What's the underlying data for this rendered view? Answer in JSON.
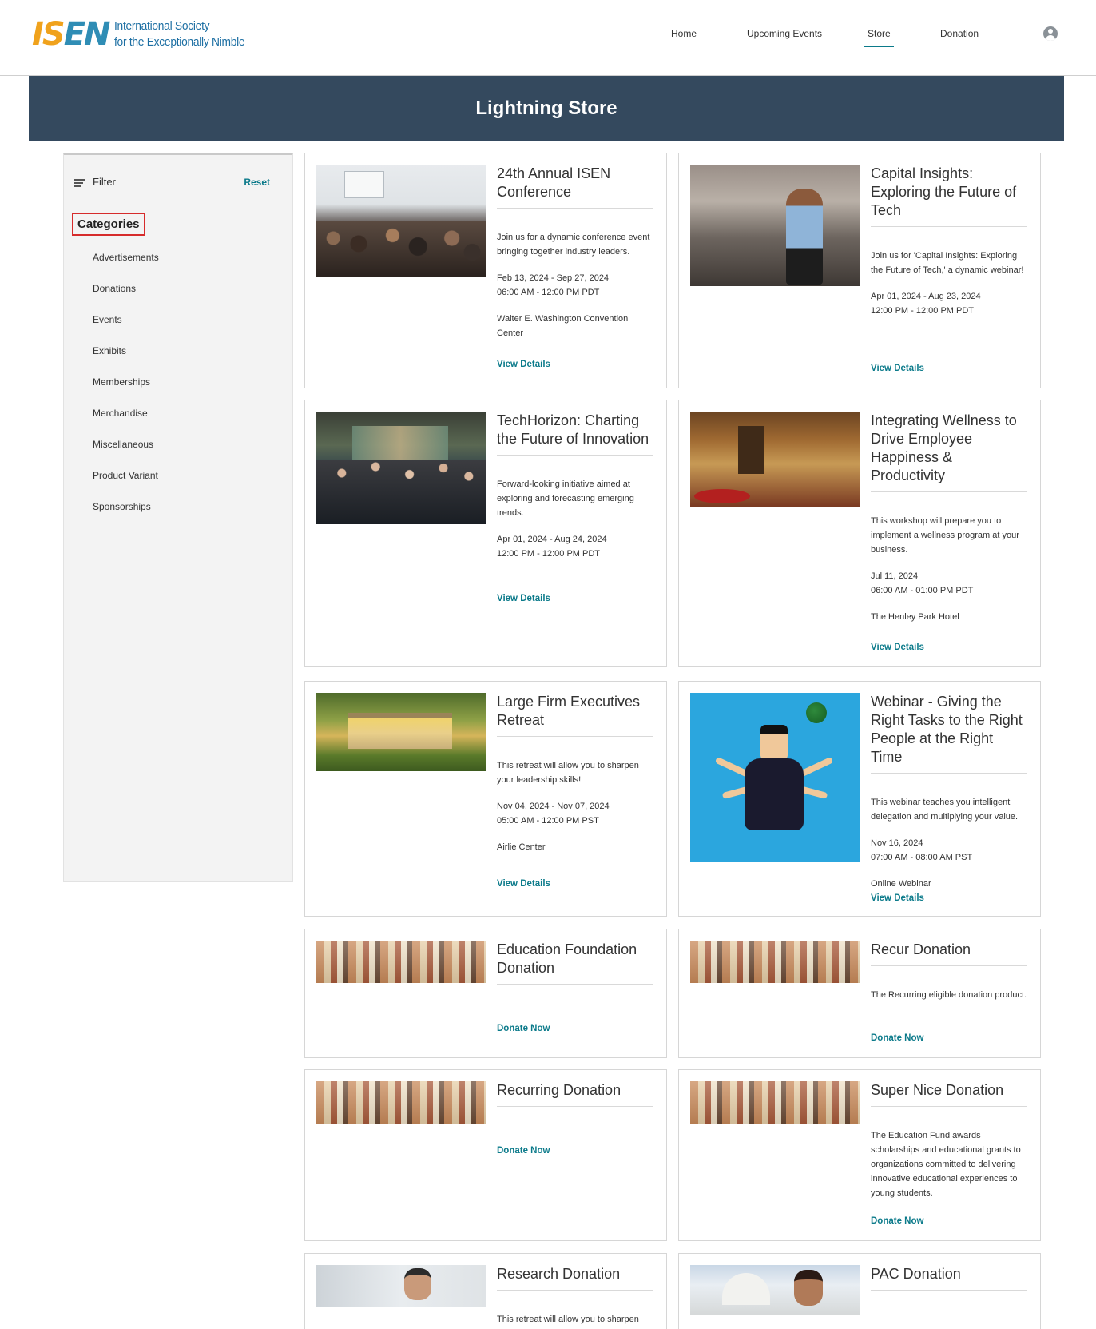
{
  "header": {
    "logo_mark_a": "IS",
    "logo_mark_b": "EN",
    "logo_line1": "International Society",
    "logo_line2": "for the Exceptionally Nimble",
    "nav": [
      "Home",
      "Upcoming Events",
      "Store",
      "Donation"
    ],
    "active_nav": "Store"
  },
  "banner": {
    "title": "Lightning Store"
  },
  "sidebar": {
    "filter_label": "Filter",
    "reset_label": "Reset",
    "categories_title": "Categories",
    "categories": [
      "Advertisements",
      "Donations",
      "Events",
      "Exhibits",
      "Memberships",
      "Merchandise",
      "Miscellaneous",
      "Product Variant",
      "Sponsorships"
    ]
  },
  "cards": [
    {
      "title": "24th Annual ISEN Conference",
      "desc": "Join us for a dynamic conference event bringing together industry leaders.",
      "dates": "Feb 13, 2024 - Sep 27, 2024",
      "time": "06:00 AM - 12:00 PM PDT",
      "location": "Walter E. Washington Convention Center",
      "link": "View Details"
    },
    {
      "title": "Capital Insights: Exploring the Future of Tech",
      "desc": "Join us for 'Capital Insights: Exploring the Future of Tech,' a dynamic webinar!",
      "dates": "Apr 01, 2024 - Aug 23, 2024",
      "time": "12:00 PM - 12:00 PM PDT",
      "link": "View Details"
    },
    {
      "title": "TechHorizon: Charting the Future of Innovation",
      "desc": "Forward-looking initiative aimed at exploring and forecasting emerging trends.",
      "dates": "Apr 01, 2024 - Aug 24, 2024",
      "time": "12:00 PM - 12:00 PM PDT",
      "link": "View Details"
    },
    {
      "title": "Integrating Wellness to Drive Employee Happiness & Productivity",
      "desc": "This workshop will prepare you to implement a wellness program at your business.",
      "dates": "Jul 11, 2024",
      "time": "06:00 AM - 01:00 PM PDT",
      "location": "The Henley Park Hotel",
      "link": "View Details"
    },
    {
      "title": "Large Firm Executives Retreat",
      "desc": "This retreat will allow you to sharpen your leadership skills!",
      "dates": "Nov 04, 2024 - Nov 07, 2024",
      "time": "05:00 AM - 12:00 PM PST",
      "location": "Airlie Center",
      "link": "View Details"
    },
    {
      "title": "Webinar - Giving the Right Tasks to the Right People at the Right Time",
      "desc": "This webinar teaches you intelligent delegation and multiplying your value.",
      "dates": "Nov 16, 2024",
      "time": "07:00 AM - 08:00 AM PST",
      "location": "Online Webinar",
      "link": "View Details"
    },
    {
      "title": "Education Foundation Donation",
      "link": "Donate Now"
    },
    {
      "title": "Recur Donation",
      "desc": "The Recurring eligible donation product.",
      "link": "Donate Now"
    },
    {
      "title": "Recurring Donation",
      "link": "Donate Now"
    },
    {
      "title": "Super Nice Donation",
      "desc": "The Education Fund awards scholarships and educational grants to organizations committed to delivering innovative educational experiences to young students.",
      "link": "Donate Now"
    },
    {
      "title": "Research Donation",
      "desc": "This retreat will allow you to sharpen"
    },
    {
      "title": "PAC Donation"
    }
  ],
  "colors": {
    "banner": "#34495e",
    "accent": "#0b7a8a",
    "highlight_border": "#d62b2b"
  }
}
